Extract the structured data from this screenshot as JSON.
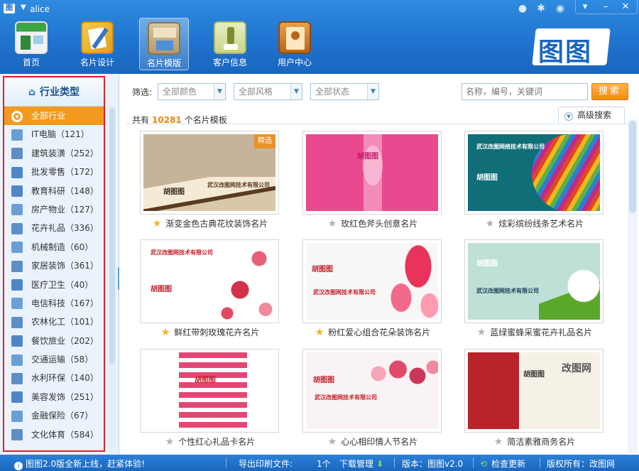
{
  "window": {
    "username": "alice",
    "controls": [
      "▾",
      "–",
      "✕"
    ]
  },
  "nav": {
    "items": [
      {
        "label": "首页",
        "icon": "storefront-icon"
      },
      {
        "label": "名片设计",
        "icon": "design-icon"
      },
      {
        "label": "名片模版",
        "icon": "template-icon"
      },
      {
        "label": "客户信息",
        "icon": "customer-icon"
      },
      {
        "label": "用户中心",
        "icon": "user-center-icon"
      }
    ],
    "active_index": 2,
    "logo_text": "图图"
  },
  "sidebar": {
    "title": "行业类型",
    "items": [
      {
        "label": "全部行业",
        "icon": "all-industries-icon"
      },
      {
        "label": "IT电脑（121）",
        "icon": "computer-icon"
      },
      {
        "label": "建筑装潢（252）",
        "icon": "paint-roller-icon"
      },
      {
        "label": "批发零售（172）",
        "icon": "cart-icon"
      },
      {
        "label": "教育科研（148）",
        "icon": "graduation-icon"
      },
      {
        "label": "房产物业（127）",
        "icon": "building-icon"
      },
      {
        "label": "花卉礼品（336）",
        "icon": "gift-icon"
      },
      {
        "label": "机械制造（60）",
        "icon": "machine-icon"
      },
      {
        "label": "家居装饰（361）",
        "icon": "furniture-icon"
      },
      {
        "label": "医疗卫生（40）",
        "icon": "medical-icon"
      },
      {
        "label": "电信科技（167）",
        "icon": "satellite-icon"
      },
      {
        "label": "农林化工（101）",
        "icon": "flask-icon"
      },
      {
        "label": "餐饮旅业（202）",
        "icon": "dining-icon"
      },
      {
        "label": "交通运输（58）",
        "icon": "bus-icon"
      },
      {
        "label": "水利环保（140）",
        "icon": "tree-icon"
      },
      {
        "label": "美容发饰（251）",
        "icon": "scissors-icon"
      },
      {
        "label": "金融保险（67）",
        "icon": "finance-icon"
      },
      {
        "label": "文化体育（584）",
        "icon": "runner-icon"
      }
    ],
    "active_index": 0
  },
  "filters": {
    "label": "筛选:",
    "color": "全部颜色",
    "style": "全部风格",
    "status": "全部状态",
    "search_placeholder": "名称，编号，关键词",
    "search_button": "搜索",
    "advanced": "高级搜索"
  },
  "summary": {
    "prefix": "共有",
    "count": "10281",
    "suffix": "个名片模板"
  },
  "templates": [
    {
      "caption": "渐变金色古典花纹装饰名片",
      "star": "gold",
      "bg": "#c6b49a",
      "accent": "#8a6a3a",
      "company": "武汉改图网技术有限公司",
      "name": "胡图图",
      "badge": "精选",
      "badge_color": "#e8932a"
    },
    {
      "caption": "玫红色斧头创意名片",
      "star": "grey",
      "bg": "#e9498f",
      "accent": "#ffffff",
      "company": "",
      "name": "胡图图",
      "badge": "",
      "badge_color": ""
    },
    {
      "caption": "炫彩缤纷线条艺术名片",
      "star": "grey",
      "bg": "#0f6e78",
      "accent": "#e0452a",
      "company": "武汉改图网络技术有限公司",
      "name": "胡图图",
      "badge": "",
      "badge_color": ""
    },
    {
      "caption": "鲜红带刺玫瑰花卉名片",
      "star": "gold",
      "bg": "#ffffff",
      "accent": "#d2334a",
      "company": "武汉改图网技术有限公司",
      "name": "胡图图",
      "badge": "",
      "badge_color": ""
    },
    {
      "caption": "粉红爱心组合花朵装饰名片",
      "star": "gold",
      "bg": "#f7f7f7",
      "accent": "#e8345a",
      "company": "武汉改图网技术有限公司",
      "name": "胡图图",
      "badge": "",
      "badge_color": ""
    },
    {
      "caption": "蓝绿蜜蜂采蜜花卉礼品名片",
      "star": "grey",
      "bg": "#bfe0d6",
      "accent": "#5aa82a",
      "company": "武汉改图网技术有限公司",
      "name": "胡图图",
      "badge": "",
      "badge_color": ""
    },
    {
      "caption": "个性红心礼品卡名片",
      "star": "grey",
      "bg": "#ffffff",
      "accent": "#e0265a",
      "company": "",
      "name": "胡图图",
      "badge": "",
      "badge_color": ""
    },
    {
      "caption": "心心相印情人节名片",
      "star": "grey",
      "bg": "#faf3f5",
      "accent": "#e04a6a",
      "company": "武汉改图网技术有限公司",
      "name": "胡图图",
      "badge": "",
      "badge_color": ""
    },
    {
      "caption": "简洁素雅商务名片",
      "star": "grey",
      "bg": "#f6f1e6",
      "accent": "#b8242a",
      "company": "",
      "name": "胡图图",
      "badge": "改图网",
      "badge_color": ""
    }
  ],
  "status": {
    "announcement": "图图2.0版全新上线，赶紧体验!",
    "export_label": "导出印刷文件:",
    "export_count": "1个",
    "download": "下载管理",
    "version": "版本：图图v2.0",
    "update": "检查更新",
    "copyright": "版权所有：改图网"
  },
  "colors": {
    "header": "#1f74cf",
    "accent_orange": "#f39a1e",
    "sidebar_bg": "#eaf3fb",
    "highlight_frame": "#e0202a"
  }
}
